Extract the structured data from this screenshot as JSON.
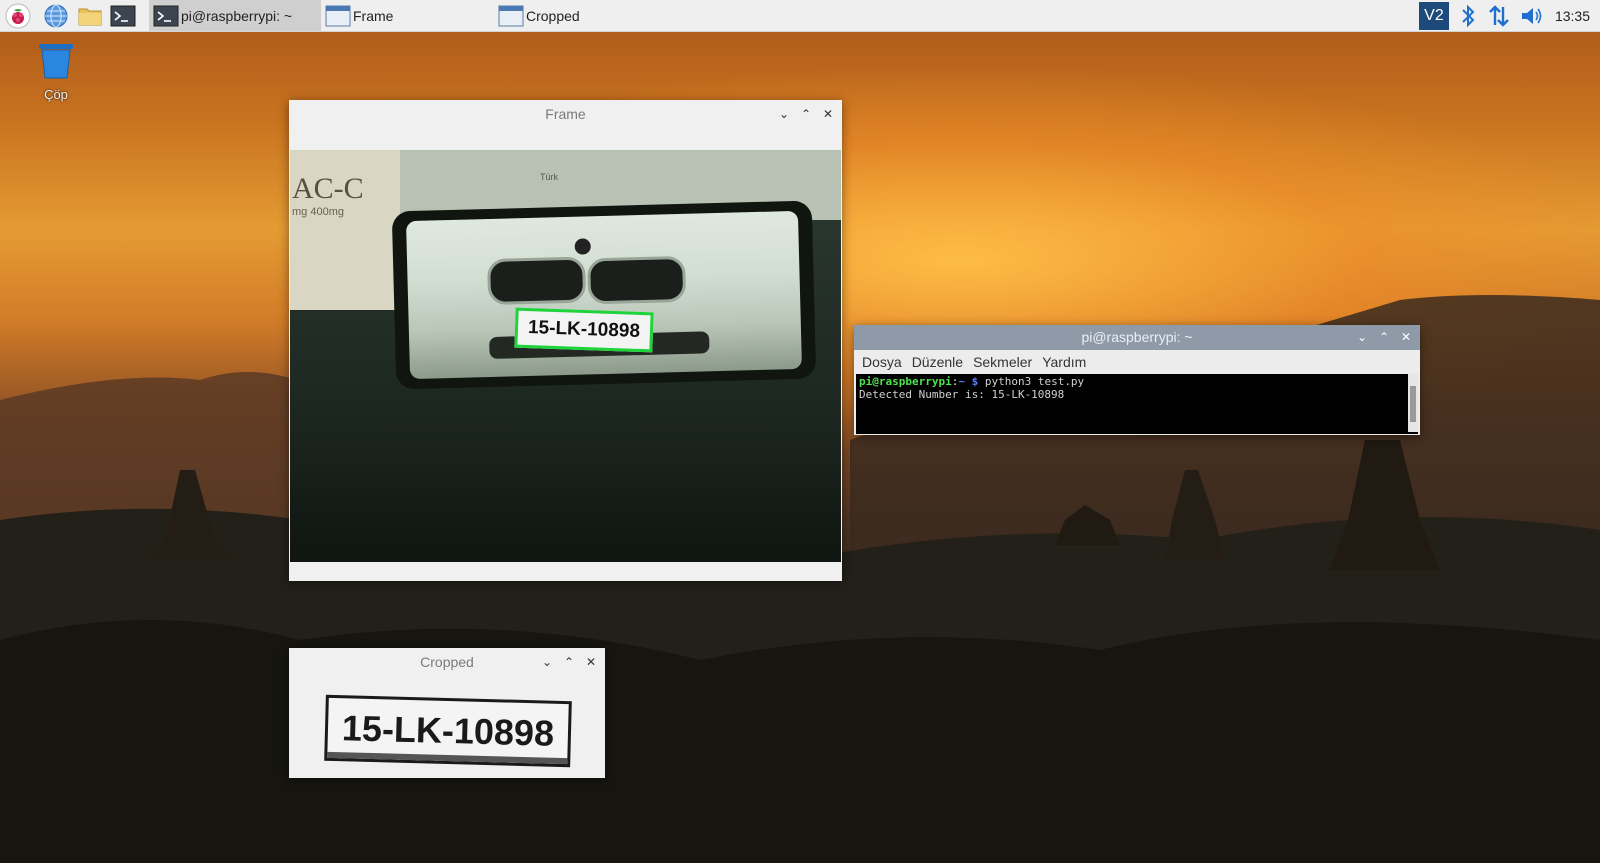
{
  "taskbar": {
    "launchers": [
      "raspberry-menu-icon",
      "web-browser-icon",
      "file-manager-icon",
      "terminal-icon"
    ],
    "tasks": [
      {
        "label": "pi@raspberrypi: ~",
        "active": true
      },
      {
        "label": "Frame",
        "active": false
      },
      {
        "label": "Cropped",
        "active": false
      }
    ],
    "tray": {
      "vnc_label": "V2",
      "icons": [
        "vnc-icon",
        "bluetooth-icon",
        "network-icon",
        "volume-icon"
      ],
      "clock": "13:35"
    }
  },
  "desktop": {
    "trash_label": "Çöp"
  },
  "frame_window": {
    "title": "Frame",
    "plate_text": "15-LK-10898",
    "poster_text": "AC-C",
    "poster_sub": "mg 400mg",
    "box_text": "Türk"
  },
  "cropped_window": {
    "title": "Cropped",
    "plate_text": "15-LK-10898"
  },
  "terminal": {
    "title": "pi@raspberrypi: ~",
    "menu": [
      "Dosya",
      "Düzenle",
      "Sekmeler",
      "Yardım"
    ],
    "prompt_user": "pi@raspberrypi",
    "prompt_sep": ":",
    "prompt_path": "~ $",
    "command": "python3 test.py",
    "output": "Detected Number is: 15-LK-10898"
  },
  "colors": {
    "terminal_titlebar": "#8f9aa8",
    "plate_box": "#1fd33b"
  }
}
